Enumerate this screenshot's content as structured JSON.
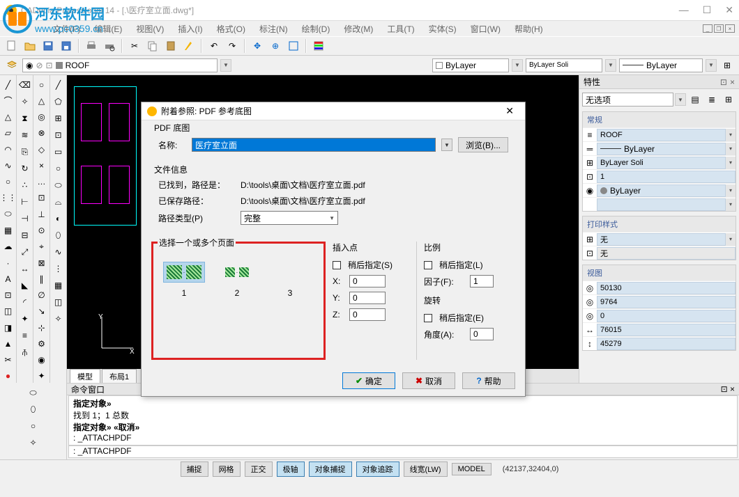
{
  "window": {
    "title": "CADopia Professional 14 - [.\\医疗室立面.dwg*]",
    "watermark_title": "河东软件园",
    "watermark_url": "www.pc0359.cn"
  },
  "menu": {
    "items": [
      "文件(F)",
      "编辑(E)",
      "视图(V)",
      "插入(I)",
      "格式(O)",
      "标注(N)",
      "绘制(D)",
      "修改(M)",
      "工具(T)",
      "实体(S)",
      "窗口(W)",
      "帮助(H)"
    ]
  },
  "layer_row": {
    "current_layer": "ROOF",
    "color_combo": "ByLayer",
    "linetype_combo": "ByLayer      Soli",
    "lineweight_combo": "ByLayer"
  },
  "tabs": {
    "model": "模型",
    "layout1": "布局1"
  },
  "properties_panel": {
    "title": "特性",
    "selector_label": "无选项",
    "sections": {
      "general": {
        "title": "常规",
        "layer": "ROOF",
        "linetype": "ByLayer",
        "linetype_scale_label": "ByLayer    Soli",
        "ltscale": "1",
        "lineweight": "ByLayer"
      },
      "plot_style": {
        "title": "打印样式",
        "style1": "无",
        "style2": "无"
      },
      "view": {
        "title": "视图",
        "vals": [
          "50130",
          "9764",
          "0",
          "76015",
          "45279"
        ]
      }
    }
  },
  "command_panel": {
    "title": "命令窗口",
    "lines": [
      "指定对象»",
      "找到 1；1 总数",
      "指定对象» «取消»",
      ": _ATTACHPDF"
    ],
    "prompt": ": _ATTACHPDF"
  },
  "status_bar": {
    "buttons": [
      "捕捉",
      "网格",
      "正交",
      "极轴",
      "对象捕捉",
      "对象追踪",
      "线宽(LW)",
      "MODEL"
    ],
    "active": [
      false,
      false,
      false,
      true,
      true,
      true,
      false,
      false
    ],
    "coords": "(42137,32404,0)"
  },
  "dialog": {
    "title": "附着参照: PDF 参考底图",
    "pdf_section": "PDF 底图",
    "name_label": "名称:",
    "name_value": "医疗室立面",
    "browse_btn": "浏览(B)...",
    "file_info_title": "文件信息",
    "found_label": "已找到，路径是：",
    "found_path": "D:\\tools\\桌面\\文档\\医疗室立面.pdf",
    "saved_label": "已保存路径：",
    "saved_path": "D:\\tools\\桌面\\文档\\医疗室立面.pdf",
    "path_type_label": "路径类型(P)",
    "path_type_value": "完整",
    "pages_title": "选择一个或多个页面",
    "page_labels": [
      "1",
      "2",
      "3"
    ],
    "insert_point": {
      "title": "插入点",
      "later": "稍后指定(S)",
      "x_label": "X:",
      "x_val": "0",
      "y_label": "Y:",
      "y_val": "0",
      "z_label": "Z:",
      "z_val": "0"
    },
    "scale": {
      "title": "比例",
      "later": "稍后指定(L)",
      "factor_label": "因子(F):",
      "factor_val": "1"
    },
    "rotation": {
      "title": "旋转",
      "later": "稍后指定(E)",
      "angle_label": "角度(A):",
      "angle_val": "0"
    },
    "ok_btn": "确定",
    "cancel_btn": "取消",
    "help_btn": "帮助"
  }
}
